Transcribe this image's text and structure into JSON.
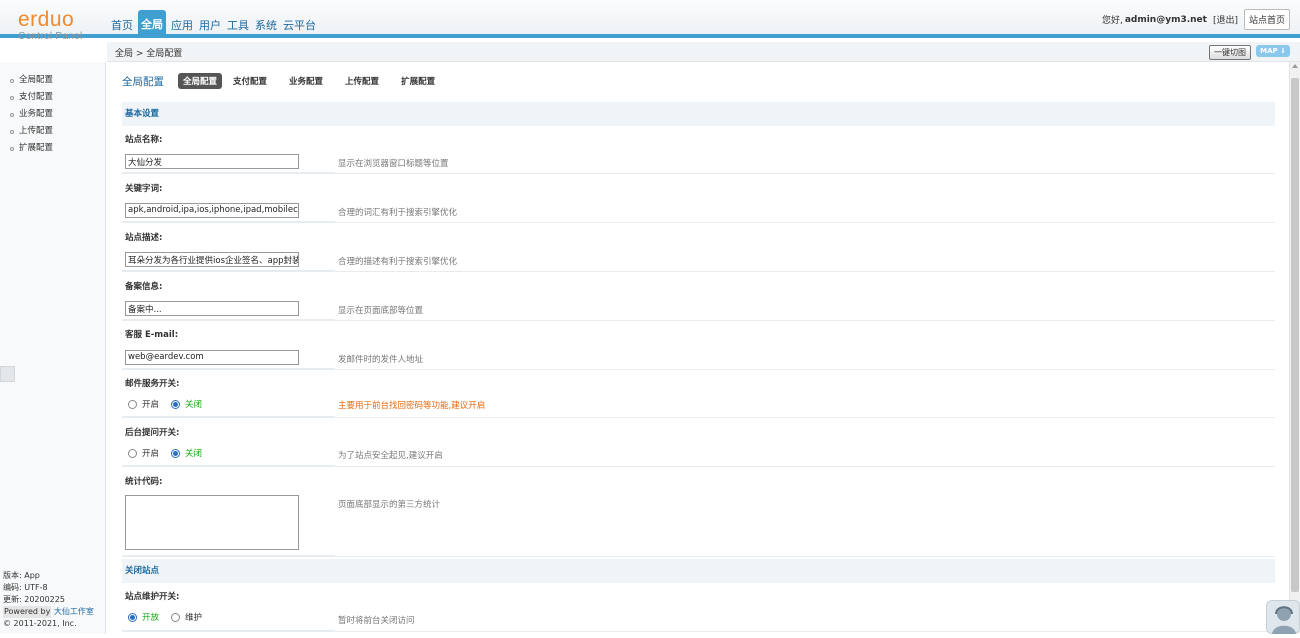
{
  "header": {
    "brand": "erduo",
    "brand_sub": "Control Panel",
    "nav": [
      {
        "label": "首页",
        "active": false
      },
      {
        "label": "全局",
        "active": true
      },
      {
        "label": "应用",
        "active": false
      },
      {
        "label": "用户",
        "active": false
      },
      {
        "label": "工具",
        "active": false
      },
      {
        "label": "系统",
        "active": false
      },
      {
        "label": "云平台",
        "active": false
      }
    ],
    "greeting": "您好,",
    "username": "admin@ym3.net",
    "logout": "[退出]",
    "home_button": "站点首页",
    "accent_color": "#3e9fd0",
    "brand_color": "#f28a2c"
  },
  "breadcrumb": {
    "text": "全局 > 全局配置",
    "switch_button": "一键切图",
    "map_badge": "MAP ⇓"
  },
  "sidebar": {
    "items": [
      {
        "label": "全局配置"
      },
      {
        "label": "支付配置"
      },
      {
        "label": "业务配置"
      },
      {
        "label": "上传配置"
      },
      {
        "label": "扩展配置"
      }
    ],
    "footer": {
      "version": "版本: App",
      "encoding": "编码: UTF-8",
      "updated": "更新: 20200225",
      "powered": "Powered by",
      "studio": "大仙工作室",
      "copyright": "© 2011-2021, Inc."
    }
  },
  "main": {
    "title": "全局配置",
    "tabs": [
      {
        "label": "全局配置",
        "active": true
      },
      {
        "label": "支付配置",
        "active": false
      },
      {
        "label": "业务配置",
        "active": false
      },
      {
        "label": "上传配置",
        "active": false
      },
      {
        "label": "扩展配置",
        "active": false
      }
    ],
    "section_basic": "基本设置",
    "fields": {
      "site_name": {
        "label": "站点名称:",
        "value": "大仙分发",
        "hint": "显示在浏览器窗口标题等位置"
      },
      "keywords": {
        "label": "关键字词:",
        "value": "apk,android,ipa,ios,iphone,ipad,mobilecon",
        "hint": "合理的词汇有利于搜索引擎优化"
      },
      "description": {
        "label": "站点描述:",
        "value": "耳朵分发为各行业提供ios企业签名、app封装、",
        "hint": "合理的描述有利于搜索引擎优化"
      },
      "icp": {
        "label": "备案信息:",
        "value": "备案中...",
        "hint": "显示在页面底部等位置"
      },
      "email": {
        "label": "客服 E-mail:",
        "value": "web@eardev.com",
        "hint": "发邮件时的发件人地址"
      }
    },
    "mail_switch": {
      "label": "邮件服务开关:",
      "on": "开启",
      "off": "关闭",
      "selected": "off",
      "hint": "主要用于前台找回密码等功能,建议开启"
    },
    "admin_q_switch": {
      "label": "后台提问开关:",
      "on": "开启",
      "off": "关闭",
      "selected": "off",
      "hint": "为了站点安全起见,建议开启"
    },
    "stats_code": {
      "label": "统计代码:",
      "hint": "页面底部显示的第三方统计"
    },
    "section_close": "关闭站点",
    "maintenance": {
      "label": "站点维护开关:",
      "on": "开放",
      "off": "维护",
      "selected": "on",
      "hint": "暂时将前台关闭访问"
    }
  }
}
